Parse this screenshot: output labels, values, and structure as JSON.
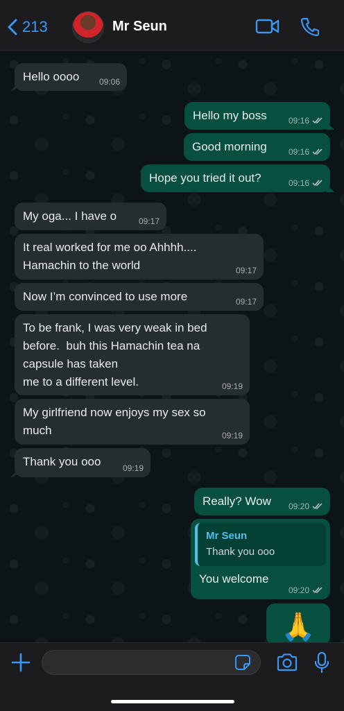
{
  "header": {
    "back_count": "213",
    "contact_name": "Mr Seun"
  },
  "messages": [
    {
      "text": "Hello oooo",
      "time": "09:06",
      "dir": "in"
    },
    {
      "text": "Hello my boss",
      "time": "09:16",
      "dir": "out"
    },
    {
      "text": "Good morning",
      "time": "09:16",
      "dir": "out"
    },
    {
      "text": "Hope you tried it out?",
      "time": "09:16",
      "dir": "out"
    },
    {
      "text": "My oga... I have o",
      "time": "09:17",
      "dir": "in"
    },
    {
      "text": "It real worked for me oo Ahhhh....\nHamachin to the world",
      "time": "09:17",
      "dir": "in"
    },
    {
      "text": "Now I’m convinced to use more",
      "time": "09:17",
      "dir": "in"
    },
    {
      "text": "To be frank, I was very weak in bed\nbefore.  buh this Hamachin tea na\ncapsule has taken\nme to a different level.",
      "time": "09:19",
      "dir": "in"
    },
    {
      "text": "My girlfriend now enjoys my sex so\nmuch",
      "time": "09:19",
      "dir": "in"
    },
    {
      "text": "Thank you ooo",
      "time": "09:19",
      "dir": "in"
    },
    {
      "text": "Really? Wow",
      "time": "09:20",
      "dir": "out"
    },
    {
      "reply_name": "Mr Seun",
      "reply_text": "Thank you ooo",
      "text": "You welcome",
      "time": "09:20",
      "dir": "out"
    },
    {
      "text": "🙏",
      "dir": "out"
    }
  ],
  "footer": {
    "input_value": "",
    "input_placeholder": ""
  },
  "icons": [
    "chevron-left-icon",
    "video-call-icon",
    "phone-icon",
    "plus-icon",
    "sticker-icon",
    "camera-icon",
    "microphone-icon"
  ],
  "colors": {
    "accent": "#3a98f4",
    "incoming_bubble": "#262d31",
    "outgoing_bubble": "#07503f",
    "reply_name": "#53bdeb"
  }
}
